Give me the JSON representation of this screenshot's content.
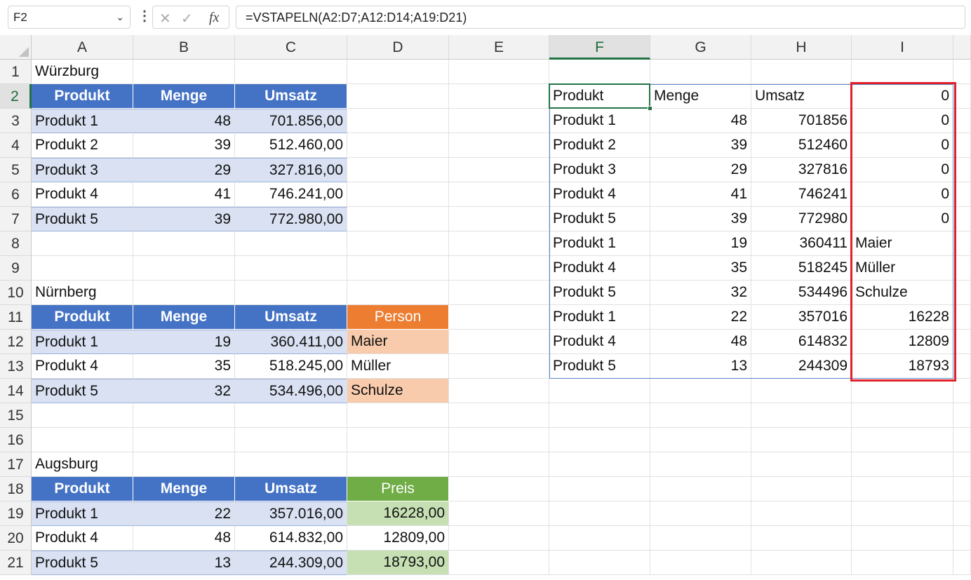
{
  "formula_bar": {
    "name_box": "F2",
    "dots": "⋮",
    "cancel_glyph": "✕",
    "enter_glyph": "✓",
    "fx_glyph": "fx",
    "formula": "=VSTAPELN(A2:D7;A12:D14;A19:D21)"
  },
  "columns": [
    "A",
    "B",
    "C",
    "D",
    "E",
    "F",
    "G",
    "H",
    "I"
  ],
  "rows": [
    "1",
    "2",
    "3",
    "4",
    "5",
    "6",
    "7",
    "8",
    "9",
    "10",
    "11",
    "12",
    "13",
    "14",
    "15",
    "16",
    "17",
    "18",
    "19",
    "20",
    "21"
  ],
  "selected_cell": "F2",
  "sheet": {
    "wurzburg": {
      "title": "Würzburg",
      "headers": [
        "Produkt",
        "Menge",
        "Umsatz"
      ],
      "rows": [
        [
          "Produkt 1",
          "48",
          "701.856,00"
        ],
        [
          "Produkt 2",
          "39",
          "512.460,00"
        ],
        [
          "Produkt 3",
          "29",
          "327.816,00"
        ],
        [
          "Produkt 4",
          "41",
          "746.241,00"
        ],
        [
          "Produkt 5",
          "39",
          "772.980,00"
        ]
      ]
    },
    "nurnberg": {
      "title": "Nürnberg",
      "headers": [
        "Produkt",
        "Menge",
        "Umsatz",
        "Person"
      ],
      "rows": [
        [
          "Produkt 1",
          "19",
          "360.411,00",
          "Maier"
        ],
        [
          "Produkt 4",
          "35",
          "518.245,00",
          "Müller"
        ],
        [
          "Produkt 5",
          "32",
          "534.496,00",
          "Schulze"
        ]
      ]
    },
    "augsburg": {
      "title": "Augsburg",
      "headers": [
        "Produkt",
        "Menge",
        "Umsatz",
        "Preis"
      ],
      "rows": [
        [
          "Produkt 1",
          "22",
          "357.016,00",
          "16228,00"
        ],
        [
          "Produkt 4",
          "48",
          "614.832,00",
          "12809,00"
        ],
        [
          "Produkt 5",
          "13",
          "244.309,00",
          "18793,00"
        ]
      ]
    },
    "spill": {
      "rows": [
        [
          "Produkt",
          "Menge",
          "Umsatz",
          "0"
        ],
        [
          "Produkt 1",
          "48",
          "701856",
          "0"
        ],
        [
          "Produkt 2",
          "39",
          "512460",
          "0"
        ],
        [
          "Produkt 3",
          "29",
          "327816",
          "0"
        ],
        [
          "Produkt 4",
          "41",
          "746241",
          "0"
        ],
        [
          "Produkt 5",
          "39",
          "772980",
          "0"
        ],
        [
          "Produkt 1",
          "19",
          "360411",
          "Maier"
        ],
        [
          "Produkt 4",
          "35",
          "518245",
          "Müller"
        ],
        [
          "Produkt 5",
          "32",
          "534496",
          "Schulze"
        ],
        [
          "Produkt 1",
          "22",
          "357016",
          "16228"
        ],
        [
          "Produkt 4",
          "48",
          "614832",
          "12809"
        ],
        [
          "Produkt 5",
          "13",
          "244309",
          "18793"
        ]
      ]
    }
  },
  "colors": {
    "header_blue": "#4472c4",
    "band_blue": "#d9e1f2",
    "orange": "#ed7d31",
    "peach": "#f8cbad",
    "green": "#70ad47",
    "light_green": "#c6e0b4",
    "highlight_red": "#e0202a",
    "excel_green": "#217346"
  }
}
